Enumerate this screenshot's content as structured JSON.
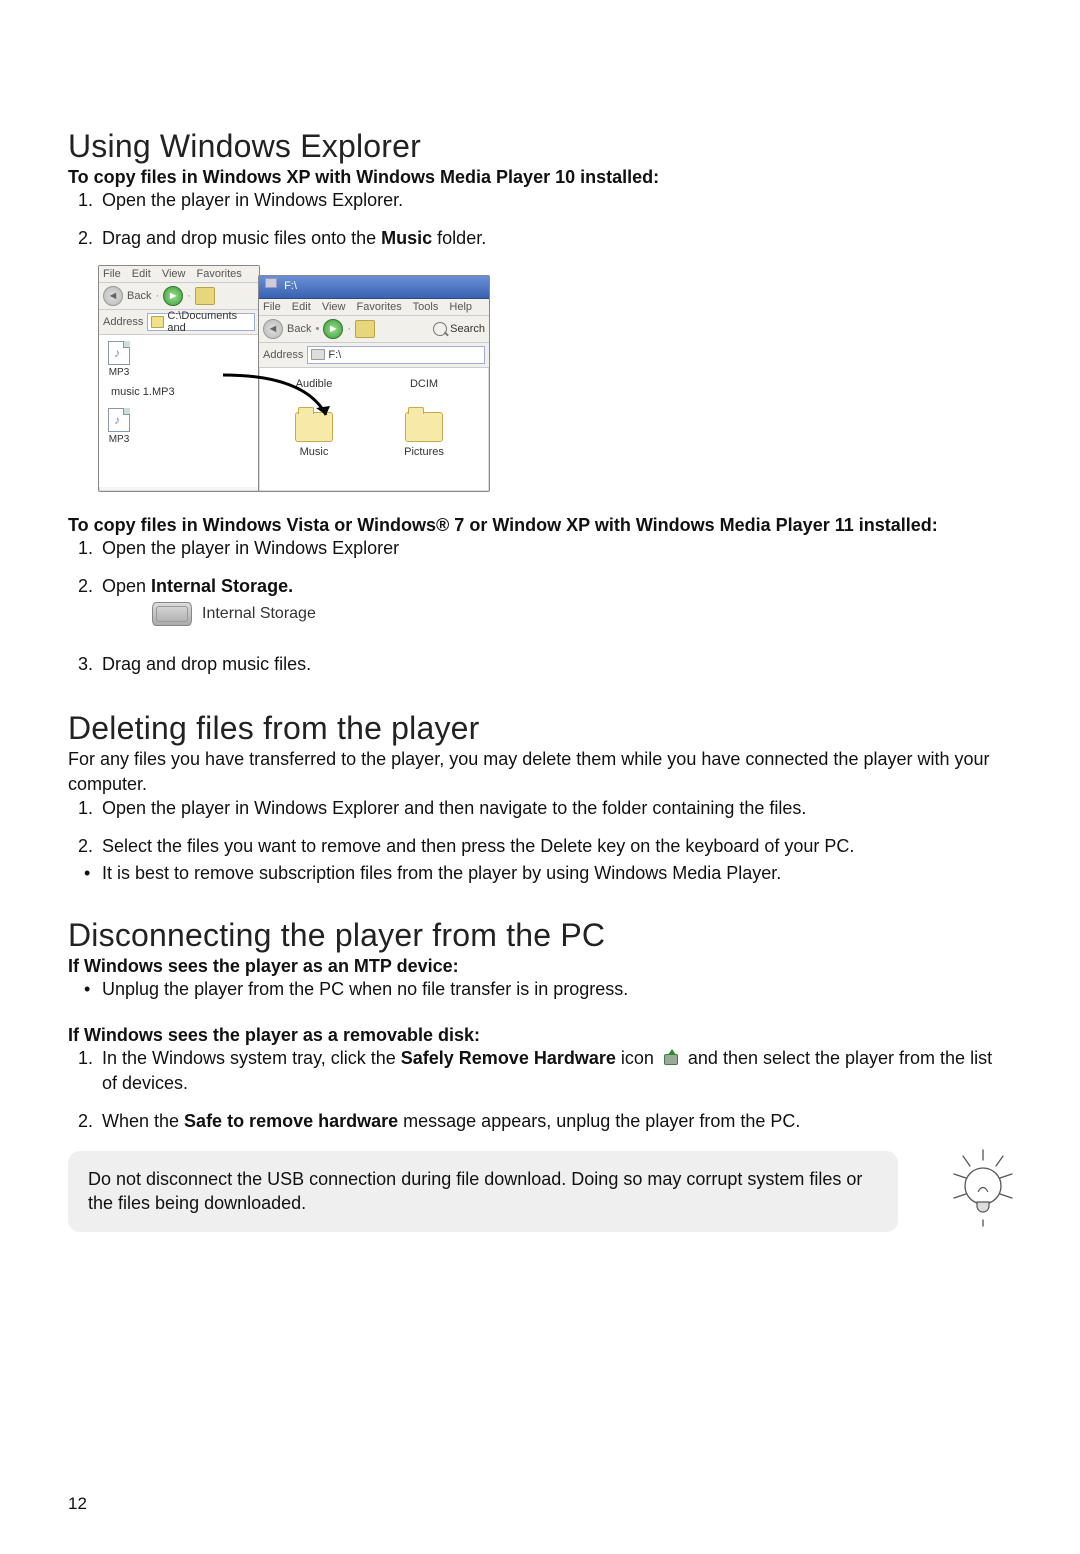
{
  "page_number": "12",
  "sections": {
    "using": {
      "title": "Using Windows Explorer",
      "lead1": "To copy files in Windows XP with Windows Media Player 10 installed:",
      "step1": "Open the player in Windows Explorer.",
      "step2_a": "Drag and drop music files onto the ",
      "step2_bold": "Music",
      "step2_b": " folder.",
      "lead2": "To copy files in Windows Vista or Windows® 7 or Window XP with Windows Media Player 11 installed:",
      "step_b1": "Open the player in Windows Explorer",
      "step_b2_a": "Open ",
      "step_b2_bold": "Internal Storage.",
      "internal_storage_label": "Internal Storage",
      "step_b3": "Drag and drop music files."
    },
    "deleting": {
      "title": "Deleting files from the player",
      "intro": "For any files you have transferred to the player, you may delete them while you have connected the player with your computer.",
      "step1": "Open the player in Windows Explorer and then navigate to the folder containing the files.",
      "step2": "Select the files you want to remove and then press the Delete key on the keyboard of your PC.",
      "bullet": "It is best to remove subscription files from the player by using Windows Media Player."
    },
    "disconnect": {
      "title": "Disconnecting the player from the PC",
      "lead_mtp": "If Windows sees the player as an MTP device:",
      "mtp_bullet": "Unplug the player from the PC when no file transfer is in progress.",
      "lead_rd": "If Windows sees the player as a removable disk:",
      "rd1_a": "In the Windows system tray, click the ",
      "rd1_bold": "Safely Remove Hardware",
      "rd1_b": " icon ",
      "rd1_c": " and then select the player from the list of devices.",
      "rd2_a": "When the ",
      "rd2_bold": "Safe to remove hardware",
      "rd2_b": " message appears, unplug the player from the PC.",
      "note": "Do not disconnect the USB connection during file download. Doing so may corrupt system files or the files being downloaded."
    }
  },
  "screenshot": {
    "back_window": {
      "menu": {
        "file": "File",
        "edit": "Edit",
        "view": "View",
        "favorites": "Favorites"
      },
      "back_label": "Back",
      "address_label": "Address",
      "address_value": "C:\\Documents and",
      "file1_caption": "MP3",
      "file1_name": "music 1.MP3",
      "file2_caption": "MP3"
    },
    "front_window": {
      "title": "F:\\",
      "menu": {
        "file": "File",
        "edit": "Edit",
        "view": "View",
        "favorites": "Favorites",
        "tools": "Tools",
        "help": "Help"
      },
      "back_label": "Back",
      "search_label": "Search",
      "address_label": "Address",
      "address_value": "F:\\",
      "folders": {
        "audible": "Audible",
        "dcim": "DCIM",
        "music": "Music",
        "pictures": "Pictures"
      }
    }
  }
}
